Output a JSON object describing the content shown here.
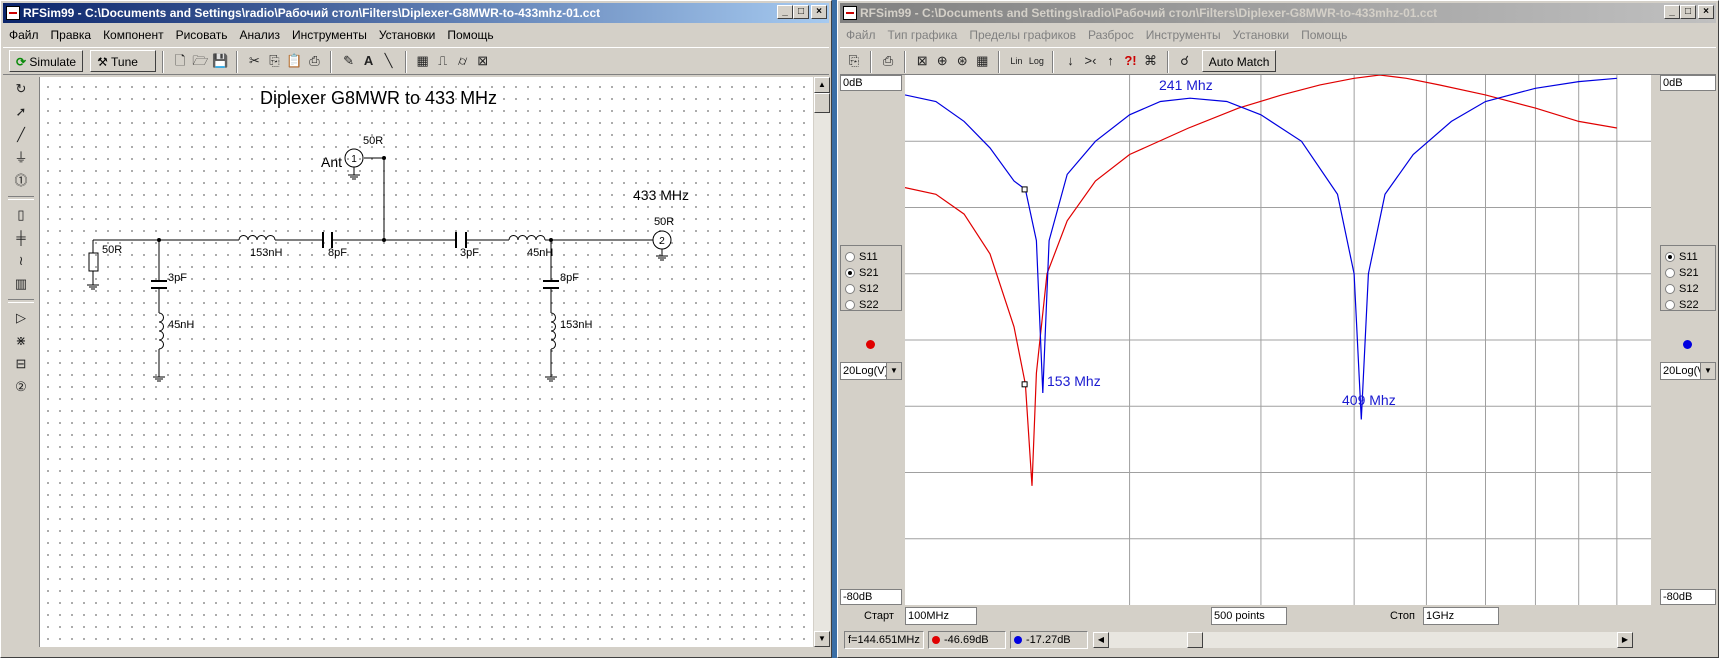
{
  "left_window": {
    "title": "RFSim99 - C:\\Documents and Settings\\radio\\Рабочий стол\\Filters\\Diplexer-G8MWR-to-433mhz-01.cct",
    "menu": [
      "Файл",
      "Правка",
      "Компонент",
      "Рисовать",
      "Анализ",
      "Инструменты",
      "Установки",
      "Помощь"
    ],
    "toolbar": {
      "simulate_label": "Simulate",
      "tune_label": "Tune"
    },
    "schematic": {
      "title": "Diplexer G8MWR to 433 MHz",
      "ant_label": "Ant",
      "port1_impedance": "50R",
      "port1_number": "1",
      "port2_impedance": "50R",
      "port2_number": "2",
      "freq_label": "433 MHz",
      "source_resistor": "50R",
      "l_series_left": "153nH",
      "c_series_left": "8pF",
      "c_series_right": "3pF",
      "l_series_right": "45nH",
      "c_shunt_left": "3pF",
      "l_shunt_left": "45nH",
      "c_shunt_right": "8pF",
      "l_shunt_right": "153nH"
    }
  },
  "right_window": {
    "title": "RFSim99 - C:\\Documents and Settings\\radio\\Рабочий стол\\Filters\\Diplexer-G8MWR-to-433mhz-01.cct",
    "menu": [
      "Файл",
      "Тип графика",
      "Пределы графиков",
      "Разброс",
      "Инструменты",
      "Установки",
      "Помощь"
    ],
    "toolbar": {
      "auto_match_label": "Auto Match"
    },
    "left_panel": {
      "top_db": "0dB",
      "bottom_db": "-80dB",
      "params": [
        "S11",
        "S21",
        "S12",
        "S22"
      ],
      "selected": "S21",
      "trace_color": "#e00000",
      "scale": "20Log(V)"
    },
    "right_panel": {
      "top_db": "0dB",
      "bottom_db": "-80dB",
      "params": [
        "S11",
        "S21",
        "S12",
        "S22"
      ],
      "selected": "S11",
      "trace_color": "#0000e0",
      "scale": "20Log(V)"
    },
    "annotations": {
      "a241": "241 Mhz",
      "a153": "153 Mhz",
      "a409": "409 Mhz"
    },
    "bottom": {
      "start_label": "Старт",
      "start_value": "100MHz",
      "points_value": "500 points",
      "stop_label": "Стоп",
      "stop_value": "1GHz"
    },
    "status": {
      "freq": "f=144.651MHz",
      "red_value": "-46.69dB",
      "blue_value": "-17.27dB"
    }
  },
  "chart_data": {
    "type": "line",
    "x_range_mhz": [
      100,
      1000
    ],
    "ylim": [
      -80,
      0
    ],
    "y_unit": "dB",
    "grid": true,
    "series": [
      {
        "name": "S21",
        "color": "#e00000",
        "points": [
          [
            100,
            -17
          ],
          [
            110,
            -18
          ],
          [
            120,
            -21
          ],
          [
            130,
            -27
          ],
          [
            140,
            -38
          ],
          [
            145,
            -46.69
          ],
          [
            148,
            -62
          ],
          [
            150,
            -45
          ],
          [
            155,
            -30
          ],
          [
            165,
            -22
          ],
          [
            180,
            -16
          ],
          [
            200,
            -12
          ],
          [
            240,
            -8
          ],
          [
            280,
            -5
          ],
          [
            320,
            -3
          ],
          [
            360,
            -1.5
          ],
          [
            400,
            -0.5
          ],
          [
            433,
            0
          ],
          [
            470,
            -0.5
          ],
          [
            520,
            -1.5
          ],
          [
            600,
            -3
          ],
          [
            700,
            -5
          ],
          [
            800,
            -7
          ],
          [
            900,
            -8
          ]
        ]
      },
      {
        "name": "S11",
        "color": "#0000e0",
        "points": [
          [
            100,
            -3
          ],
          [
            110,
            -4
          ],
          [
            120,
            -7
          ],
          [
            130,
            -11
          ],
          [
            140,
            -16
          ],
          [
            145,
            -17.27
          ],
          [
            150,
            -25
          ],
          [
            153,
            -48
          ],
          [
            156,
            -25
          ],
          [
            165,
            -15
          ],
          [
            180,
            -10
          ],
          [
            200,
            -6
          ],
          [
            220,
            -4
          ],
          [
            241,
            -3.5
          ],
          [
            270,
            -4
          ],
          [
            300,
            -6
          ],
          [
            340,
            -10
          ],
          [
            380,
            -18
          ],
          [
            400,
            -30
          ],
          [
            409,
            -52
          ],
          [
            418,
            -30
          ],
          [
            440,
            -18
          ],
          [
            480,
            -12
          ],
          [
            540,
            -7
          ],
          [
            600,
            -4
          ],
          [
            700,
            -2
          ],
          [
            800,
            -1
          ],
          [
            900,
            -0.5
          ]
        ]
      }
    ]
  }
}
